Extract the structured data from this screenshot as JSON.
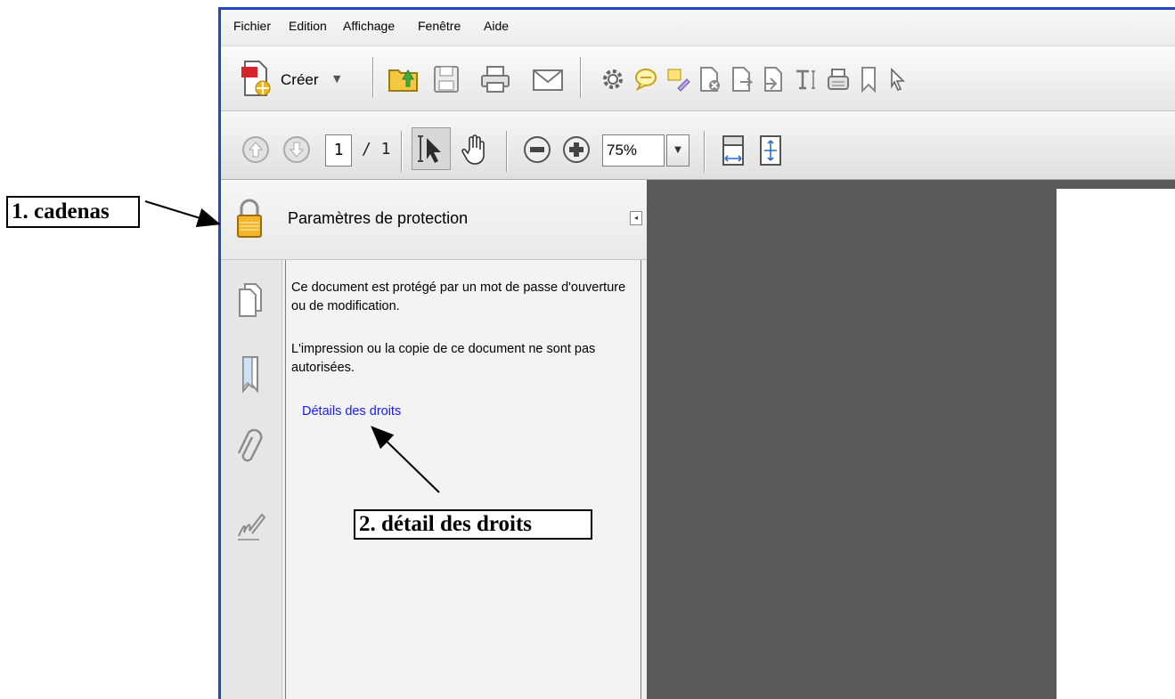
{
  "menu": [
    "Fichier",
    "Edition",
    "Affichage",
    "Fenêtre",
    "Aide"
  ],
  "toolbar": {
    "create_label": "Créer",
    "create_caret": "▼",
    "icons": [
      "create-pdf-icon",
      "open-folder-icon",
      "save-icon",
      "print-icon",
      "email-icon",
      "gear-icon",
      "comment-icon",
      "highlight-icon",
      "delete-page-icon",
      "extract-page-icon",
      "insert-page-icon",
      "text-tool-icon",
      "typewriter-icon",
      "bookmark-icon",
      "select-arrow-icon"
    ]
  },
  "navigation": {
    "current_page": "1",
    "total_pages": "/ 1",
    "zoom": "75%",
    "zoom_caret": "▼"
  },
  "panel": {
    "title": "Paramètres de protection",
    "collapse": "◂",
    "paragraph1": "Ce document est protégé par un mot de passe d'ouverture ou de modification.",
    "paragraph2": "L'impression ou la copie de ce document ne sont pas autorisées.",
    "link": "Détails des droits"
  },
  "nav_strip": [
    "pages-icon",
    "bookmarks-icon",
    "attachments-icon",
    "signatures-icon"
  ],
  "annotations": {
    "callout1": "1. cadenas",
    "callout2": "2. détail des droits"
  },
  "colors": {
    "window_border": "#1d47c5",
    "link": "#1a1aff",
    "viewer_bg": "#595959",
    "lock_gold": "#f1b62e"
  }
}
